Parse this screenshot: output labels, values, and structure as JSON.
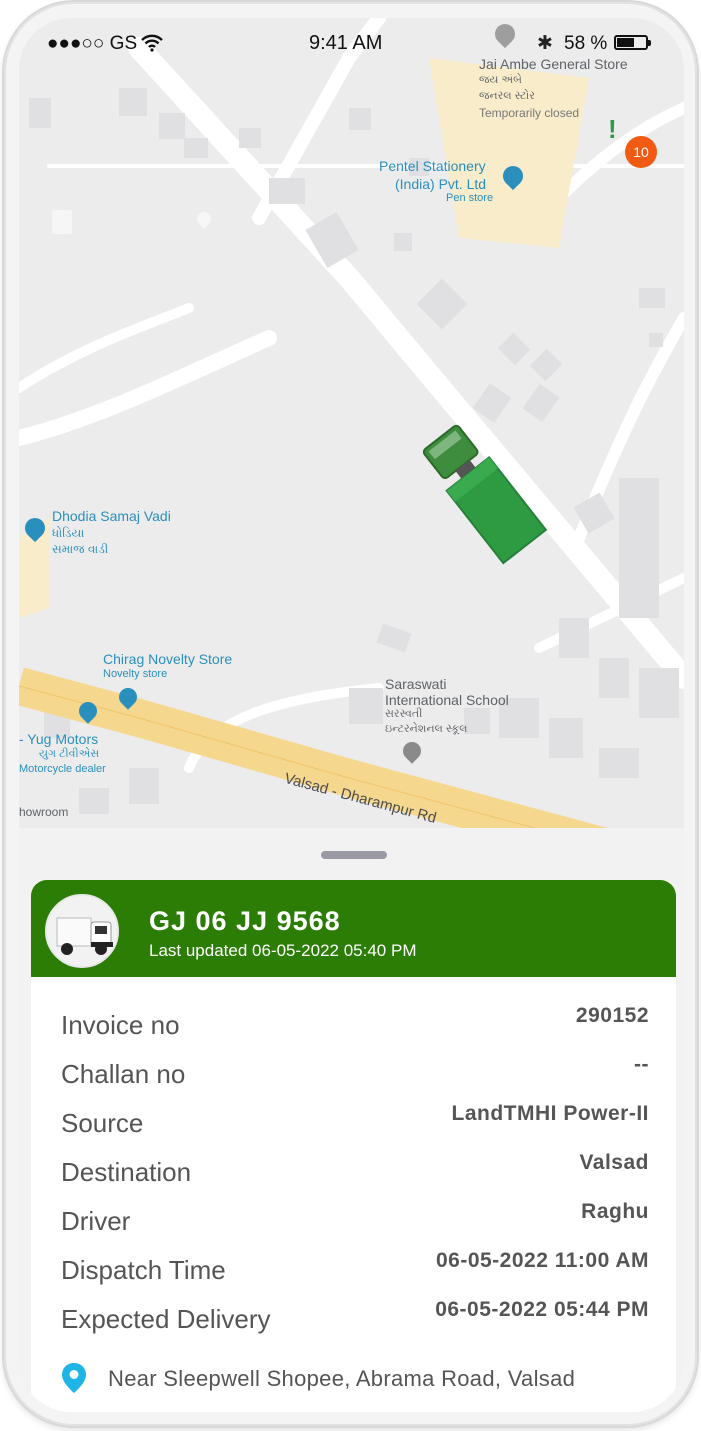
{
  "status_bar": {
    "carrier": "●●●○○ GS",
    "time": "9:41 AM",
    "battery_percent": "58 %"
  },
  "map": {
    "labels": {
      "jai_ambe": "Jai Ambe General Store",
      "jai_ambe_guj": "જય અંબે",
      "jai_ambe_guj2": "જનરલ સ્ટોર",
      "temporarily_closed": "Temporarily closed",
      "pentel_1": "Pentel Stationery",
      "pentel_2": "(India) Pvt. Ltd",
      "pen_store": "Pen store",
      "dhodia_1": "Dhodia Samaj Vadi",
      "dhodia_guj1": "ધોડિયા",
      "dhodia_guj2": "સમાજ વાડી",
      "chirag": "Chirag Novelty Store",
      "novelty_store": "Novelty store",
      "yug": "- Yug Motors",
      "yug_guj": "યુગ ટીવીએસ",
      "motorcycle": "Motorcycle dealer",
      "saraswati_1": "Saraswati",
      "saraswati_2": "International School",
      "saraswati_guj1": "સરસ્વતી",
      "saraswati_guj2": "ઇન્ટરનેશનલ સ્કૂલ",
      "road": "Valsad - Dharampur Rd",
      "showroom": "howroom"
    },
    "notification_badge": "10",
    "colors": {
      "road_major": "#f6d78e",
      "map_bg": "#ececec",
      "truck": "#2e8b3a",
      "poi_blue": "#2a8fbd"
    }
  },
  "vehicle": {
    "number": "GJ 06 JJ 9568",
    "last_updated": "Last updated 06-05-2022 05:40 PM",
    "header_color": "#2b7d06"
  },
  "details": [
    {
      "label": "Invoice no",
      "value": "290152"
    },
    {
      "label": "Challan no",
      "value": "--"
    },
    {
      "label": "Source",
      "value": "LandTMHI Power-II"
    },
    {
      "label": "Destination",
      "value": "Valsad"
    },
    {
      "label": "Driver",
      "value": "Raghu"
    },
    {
      "label": "Dispatch Time",
      "value": "06-05-2022 11:00 AM"
    },
    {
      "label": "Expected Delivery",
      "value": "06-05-2022 05:44 PM"
    }
  ],
  "location": {
    "address": "Near Sleepwell Shopee, Abrama Road, Valsad",
    "icon": "location-pin-icon"
  }
}
